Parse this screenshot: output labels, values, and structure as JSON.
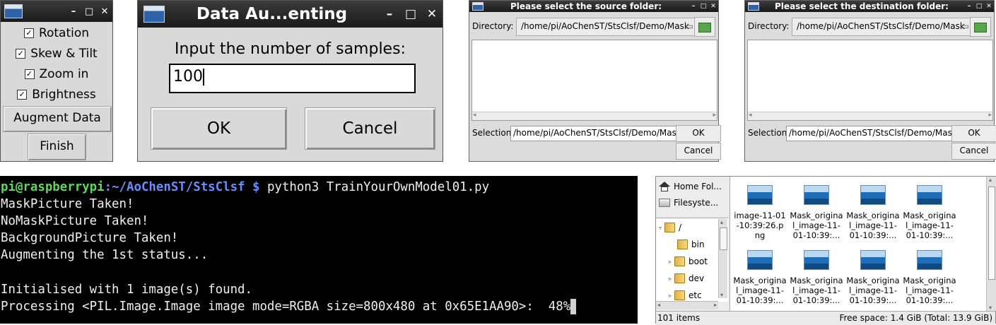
{
  "options_window": {
    "checkboxes": [
      {
        "label": "Rotation",
        "checked": true
      },
      {
        "label": "Skew & Tilt",
        "checked": true
      },
      {
        "label": "Zoom in",
        "checked": true
      },
      {
        "label": "Brightness",
        "checked": true
      }
    ],
    "augment_button": "Augment Data",
    "finish_button": "Finish"
  },
  "input_dialog": {
    "title": "Data Au...enting",
    "prompt": "Input the number of samples:",
    "value": "100",
    "ok_button": "OK",
    "cancel_button": "Cancel"
  },
  "source_dialog": {
    "title": "Please select the source folder:",
    "directory_label": "Directory:",
    "directory_value": "/home/pi/AoChenST/StsClsf/Demo/Mask",
    "selection_label": "Selection:",
    "selection_value": "/home/pi/AoChenST/StsClsf/Demo/Mask",
    "ok_button": "OK",
    "cancel_button": "Cancel"
  },
  "destination_dialog": {
    "title": "Please select the destination folder:",
    "directory_label": "Directory:",
    "directory_value": "/home/pi/AoChenST/StsClsf/Demo/Mask",
    "selection_label": "Selection:",
    "selection_value": "/home/pi/AoChenST/StsClsf/Demo/Mask",
    "ok_button": "OK",
    "cancel_button": "Cancel"
  },
  "terminal": {
    "user_host": "pi@raspberrypi",
    "path": ":~/AoChenST/StsClsf $",
    "command": " python3 TrainYourOwnModel01.py",
    "lines": [
      "MaskPicture Taken!",
      "NoMaskPicture Taken!",
      "BackgroundPicture Taken!",
      "Augmenting the 1st status...",
      "",
      "Initialised with 1 image(s) found.",
      "Processing <PIL.Image.Image image mode=RGBA size=800x480 at 0x65E1AA90>:  48%"
    ],
    "progress_percent": 48
  },
  "file_manager": {
    "places": [
      "Home Fol...",
      "Filesyste..."
    ],
    "tree": [
      {
        "label": "/",
        "expander": "▿"
      },
      {
        "label": "bin",
        "expander": ""
      },
      {
        "label": "boot",
        "expander": "▹"
      },
      {
        "label": "dev",
        "expander": "▹"
      },
      {
        "label": "etc",
        "expander": "▹"
      }
    ],
    "files": [
      [
        "image-11-01",
        "-10:39:26.p",
        "ng"
      ],
      [
        "Mask_origina",
        "l_image-11-",
        "01-10:39:..."
      ],
      [
        "Mask_origina",
        "l_image-11-",
        "01-10:39:..."
      ],
      [
        "Mask_origina",
        "l_image-11-",
        "01-10:39:..."
      ],
      [
        "Mask_origina",
        "l_image-11-",
        "01-10:39:..."
      ],
      [
        "Mask_origina",
        "l_image-11-",
        "01-10:39:..."
      ],
      [
        "Mask_origina",
        "l_image-11-",
        "01-10:39:..."
      ],
      [
        "Mask_origina",
        "l_image-11-",
        "01-10:39:..."
      ]
    ],
    "status_items": "101 items",
    "status_free": "Free space: 1.4 GiB (Total: 13.9 GiB)"
  }
}
